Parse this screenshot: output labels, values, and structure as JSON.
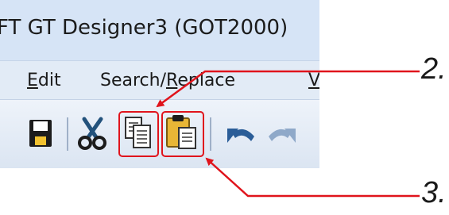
{
  "window": {
    "title": "FT GT Designer3 (GOT2000)"
  },
  "menu": {
    "items": [
      {
        "pre": "",
        "ul": "E",
        "post": "dit"
      },
      {
        "pre": "Search/",
        "ul": "R",
        "post": "eplace"
      },
      {
        "pre": "",
        "ul": "V",
        "post": ""
      }
    ]
  },
  "toolbar": {
    "buttons": [
      {
        "icon": "save-icon"
      },
      {
        "icon": "cut-icon"
      },
      {
        "icon": "copy-icon"
      },
      {
        "icon": "paste-icon"
      },
      {
        "icon": "undo-icon"
      },
      {
        "icon": "redo-icon"
      }
    ]
  },
  "callouts": [
    {
      "label": "2.",
      "target": "copy-button"
    },
    {
      "label": "3.",
      "target": "paste-button"
    }
  ],
  "colors": {
    "callout": "#e0141c",
    "highlight_border": "#e0141c"
  }
}
